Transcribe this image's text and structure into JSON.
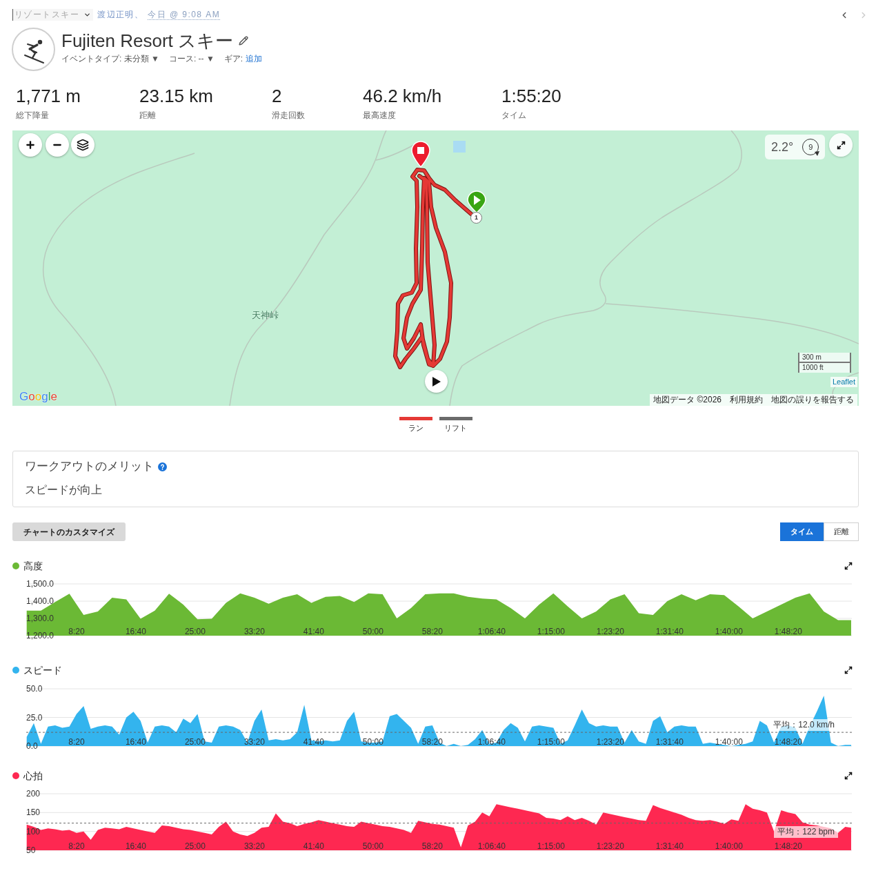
{
  "breadcrumb": {
    "activity_type": "リゾートスキー",
    "owner": "渡辺正明、",
    "date": "今日 @ 9:08 AM"
  },
  "nav_buttons": [
    {
      "kind": "prev",
      "disabled": false
    },
    {
      "kind": "next",
      "disabled": true
    }
  ],
  "title": "Fujiten Resort スキー",
  "meta": [
    {
      "kind": "dropdown",
      "label": "イベントタイプ:",
      "value": "未分類",
      "caret": "▼"
    },
    {
      "kind": "dropdown",
      "label": "コース:",
      "value": "--",
      "caret": "▼"
    },
    {
      "kind": "link",
      "label": "ギア:",
      "value": "追加"
    }
  ],
  "stats": [
    {
      "value": "1,771 m",
      "label": "総下降量"
    },
    {
      "value": "23.15 km",
      "label": "距離"
    },
    {
      "value": "2",
      "label": "滑走回数"
    },
    {
      "value": "46.2 km/h",
      "label": "最高速度"
    },
    {
      "value": "1:55:20",
      "label": "タイム"
    }
  ],
  "map": {
    "weather": {
      "temperature": "2.2°",
      "wind_speed": "9"
    },
    "lap_marker": "1",
    "place_label": "天神峠",
    "logo": "Google",
    "scale": [
      "300 m",
      "1000 ft"
    ],
    "leaflet": "Leaflet",
    "attribution": [
      "地図データ ©2026",
      "利用規約",
      "地図の誤りを報告する"
    ]
  },
  "legend": [
    {
      "label": "ラン",
      "color": "#e53935"
    },
    {
      "label": "リフト",
      "color": "#6b6b6b"
    }
  ],
  "benefits": {
    "title": "ワークアウトのメリット",
    "text": "スピードが向上"
  },
  "customize_button": "チャートのカスタマイズ",
  "axis_toggle": [
    {
      "label": "タイム",
      "selected": true
    },
    {
      "label": "距離",
      "selected": false
    }
  ],
  "charts": [
    {
      "color": "#6bb935",
      "chart_data": {
        "type": "area",
        "title": "高度",
        "x": [
          80,
          200,
          320,
          440,
          560,
          680,
          800,
          920,
          1040,
          1160,
          1280,
          1400,
          1520,
          1640,
          1760,
          1880,
          2000,
          2120,
          2240,
          2360,
          2480,
          2600,
          2720,
          2840,
          2960,
          3080,
          3200,
          3320,
          3440,
          3560,
          3680,
          3800,
          3920,
          4040,
          4160,
          4280,
          4400,
          4520,
          4640,
          4760,
          4880,
          5000,
          5120,
          5240,
          5360,
          5480,
          5600,
          5720,
          5840,
          5960,
          6080,
          6200,
          6320,
          6440,
          6560,
          6680,
          6800,
          6920,
          7030
        ],
        "values": [
          1345,
          1345,
          1395,
          1443,
          1320,
          1340,
          1420,
          1410,
          1298,
          1345,
          1443,
          1380,
          1295,
          1298,
          1390,
          1445,
          1420,
          1385,
          1420,
          1440,
          1390,
          1425,
          1430,
          1395,
          1445,
          1440,
          1300,
          1360,
          1440,
          1445,
          1445,
          1425,
          1415,
          1410,
          1360,
          1300,
          1380,
          1445,
          1370,
          1300,
          1340,
          1410,
          1440,
          1330,
          1320,
          1400,
          1440,
          1405,
          1440,
          1435,
          1370,
          1300,
          1340,
          1380,
          1420,
          1445,
          1340,
          1290,
          1290
        ],
        "xlim": [
          76,
          7036
        ],
        "ylim": [
          1200,
          1500
        ],
        "xticks": [
          {
            "value": 500,
            "label": "8:20"
          },
          {
            "value": 1000,
            "label": "16:40"
          },
          {
            "value": 1500,
            "label": "25:00"
          },
          {
            "value": 2000,
            "label": "33:20"
          },
          {
            "value": 2500,
            "label": "41:40"
          },
          {
            "value": 3000,
            "label": "50:00"
          },
          {
            "value": 3500,
            "label": "58:20"
          },
          {
            "value": 4000,
            "label": "1:06:40"
          },
          {
            "value": 4500,
            "label": "1:15:00"
          },
          {
            "value": 5000,
            "label": "1:23:20"
          },
          {
            "value": 5500,
            "label": "1:31:40"
          },
          {
            "value": 6000,
            "label": "1:40:00"
          },
          {
            "value": 6500,
            "label": "1:48:20"
          }
        ],
        "yticks": [
          {
            "value": 1200,
            "label": "1,200.0"
          },
          {
            "value": 1300,
            "label": "1,300.0"
          },
          {
            "value": 1400,
            "label": "1,400.0"
          },
          {
            "value": 1500,
            "label": "1,500.0"
          }
        ]
      }
    },
    {
      "color": "#33b4ee",
      "chart_data": {
        "type": "area",
        "title": "スピード",
        "x": [
          80,
          140,
          200,
          260,
          320,
          380,
          440,
          500,
          560,
          620,
          680,
          740,
          800,
          860,
          920,
          980,
          1040,
          1100,
          1160,
          1220,
          1280,
          1340,
          1400,
          1460,
          1520,
          1580,
          1640,
          1700,
          1760,
          1820,
          1880,
          1940,
          2000,
          2060,
          2120,
          2180,
          2240,
          2300,
          2360,
          2420,
          2480,
          2540,
          2600,
          2660,
          2720,
          2780,
          2840,
          2900,
          2960,
          3020,
          3080,
          3140,
          3200,
          3260,
          3320,
          3380,
          3440,
          3500,
          3560,
          3620,
          3680,
          3740,
          3800,
          3860,
          3920,
          3980,
          4040,
          4100,
          4160,
          4220,
          4280,
          4340,
          4400,
          4460,
          4520,
          4580,
          4640,
          4700,
          4760,
          4820,
          4880,
          4940,
          5000,
          5060,
          5120,
          5180,
          5240,
          5300,
          5360,
          5420,
          5480,
          5540,
          5600,
          5660,
          5720,
          5780,
          5840,
          5900,
          5960,
          6020,
          6080,
          6140,
          6200,
          6260,
          6320,
          6380,
          6440,
          6500,
          6560,
          6620,
          6680,
          6740,
          6800,
          6860,
          6920,
          6980,
          7030
        ],
        "values": [
          8,
          20,
          2,
          17,
          18,
          16,
          17,
          28,
          35,
          15,
          17,
          18,
          17,
          10,
          25,
          30,
          22,
          3,
          17,
          18,
          17,
          12,
          24,
          20,
          28,
          4,
          3,
          17,
          18,
          17,
          14,
          3,
          22,
          32,
          5,
          6,
          5,
          6,
          12,
          36,
          5,
          4,
          5,
          4,
          5,
          22,
          30,
          4,
          3,
          3,
          4,
          26,
          28,
          22,
          16,
          2,
          17,
          18,
          3,
          0,
          2,
          0,
          1,
          6,
          14,
          2,
          3,
          14,
          20,
          16,
          4,
          17,
          18,
          17,
          16,
          2,
          5,
          18,
          32,
          20,
          17,
          18,
          17,
          17,
          3,
          14,
          4,
          2,
          22,
          26,
          12,
          17,
          18,
          17,
          17,
          2,
          3,
          2,
          1,
          0,
          1,
          2,
          4,
          22,
          18,
          3,
          17,
          18,
          16,
          2,
          17,
          30,
          44,
          3,
          0,
          1,
          1
        ],
        "xlim": [
          76,
          7036
        ],
        "ylim": [
          0,
          50
        ],
        "xticks": [
          {
            "value": 500,
            "label": "8:20"
          },
          {
            "value": 1000,
            "label": "16:40"
          },
          {
            "value": 1500,
            "label": "25:00"
          },
          {
            "value": 2000,
            "label": "33:20"
          },
          {
            "value": 2500,
            "label": "41:40"
          },
          {
            "value": 3000,
            "label": "50:00"
          },
          {
            "value": 3500,
            "label": "58:20"
          },
          {
            "value": 4000,
            "label": "1:06:40"
          },
          {
            "value": 4500,
            "label": "1:15:00"
          },
          {
            "value": 5000,
            "label": "1:23:20"
          },
          {
            "value": 5500,
            "label": "1:31:40"
          },
          {
            "value": 6000,
            "label": "1:40:00"
          },
          {
            "value": 6500,
            "label": "1:48:20"
          }
        ],
        "yticks": [
          {
            "value": 0,
            "label": "0.0"
          },
          {
            "value": 25,
            "label": "25.0"
          },
          {
            "value": 50,
            "label": "50.0"
          }
        ],
        "ref_lines": [
          {
            "axis": "y",
            "value": 12,
            "label": "平均：12.0 km/h"
          }
        ]
      }
    },
    {
      "color": "#fe2851",
      "chart_data": {
        "type": "area",
        "title": "心拍",
        "x": [
          80,
          140,
          200,
          260,
          320,
          380,
          440,
          500,
          560,
          620,
          680,
          740,
          800,
          860,
          920,
          980,
          1040,
          1100,
          1160,
          1220,
          1280,
          1340,
          1400,
          1460,
          1520,
          1580,
          1640,
          1700,
          1760,
          1820,
          1880,
          1940,
          2000,
          2060,
          2120,
          2180,
          2240,
          2300,
          2360,
          2420,
          2480,
          2540,
          2600,
          2660,
          2720,
          2780,
          2840,
          2900,
          2960,
          3020,
          3080,
          3140,
          3200,
          3260,
          3320,
          3380,
          3440,
          3500,
          3560,
          3620,
          3680,
          3740,
          3800,
          3860,
          3920,
          3980,
          4040,
          4100,
          4160,
          4220,
          4280,
          4340,
          4400,
          4460,
          4520,
          4580,
          4640,
          4700,
          4760,
          4820,
          4880,
          4940,
          5000,
          5060,
          5120,
          5180,
          5240,
          5300,
          5360,
          5420,
          5480,
          5540,
          5600,
          5660,
          5720,
          5780,
          5840,
          5900,
          5960,
          6020,
          6080,
          6140,
          6200,
          6260,
          6320,
          6380,
          6440,
          6500,
          6560,
          6620,
          6680,
          6740,
          6800,
          6860,
          6920,
          6980,
          7030
        ],
        "values": [
          118,
          112,
          104,
          108,
          106,
          102,
          104,
          96,
          100,
          78,
          104,
          110,
          108,
          106,
          112,
          108,
          104,
          100,
          96,
          116,
          114,
          110,
          106,
          104,
          100,
          96,
          92,
          112,
          126,
          100,
          92,
          88,
          96,
          110,
          112,
          148,
          126,
          122,
          114,
          120,
          124,
          130,
          126,
          122,
          118,
          114,
          112,
          126,
          122,
          118,
          114,
          112,
          108,
          104,
          96,
          128,
          124,
          120,
          118,
          114,
          110,
          58,
          116,
          126,
          150,
          140,
          172,
          168,
          164,
          160,
          156,
          152,
          148,
          136,
          134,
          130,
          140,
          130,
          136,
          128,
          118,
          150,
          146,
          142,
          138,
          134,
          130,
          128,
          170,
          162,
          156,
          150,
          144,
          136,
          130,
          128,
          130,
          126,
          120,
          132,
          128,
          172,
          160,
          156,
          150,
          100,
          156,
          150,
          146,
          124,
          118,
          116,
          112,
          108,
          96,
          112,
          110
        ],
        "xlim": [
          76,
          7036
        ],
        "ylim": [
          50,
          200
        ],
        "xticks": [
          {
            "value": 500,
            "label": "8:20"
          },
          {
            "value": 1000,
            "label": "16:40"
          },
          {
            "value": 1500,
            "label": "25:00"
          },
          {
            "value": 2000,
            "label": "33:20"
          },
          {
            "value": 2500,
            "label": "41:40"
          },
          {
            "value": 3000,
            "label": "50:00"
          },
          {
            "value": 3500,
            "label": "58:20"
          },
          {
            "value": 4000,
            "label": "1:06:40"
          },
          {
            "value": 4500,
            "label": "1:15:00"
          },
          {
            "value": 5000,
            "label": "1:23:20"
          },
          {
            "value": 5500,
            "label": "1:31:40"
          },
          {
            "value": 6000,
            "label": "1:40:00"
          },
          {
            "value": 6500,
            "label": "1:48:20"
          }
        ],
        "yticks": [
          50,
          100,
          150,
          200
        ],
        "ref_lines": [
          {
            "axis": "y",
            "value": 122,
            "label": "平均：122 bpm"
          }
        ]
      }
    }
  ]
}
